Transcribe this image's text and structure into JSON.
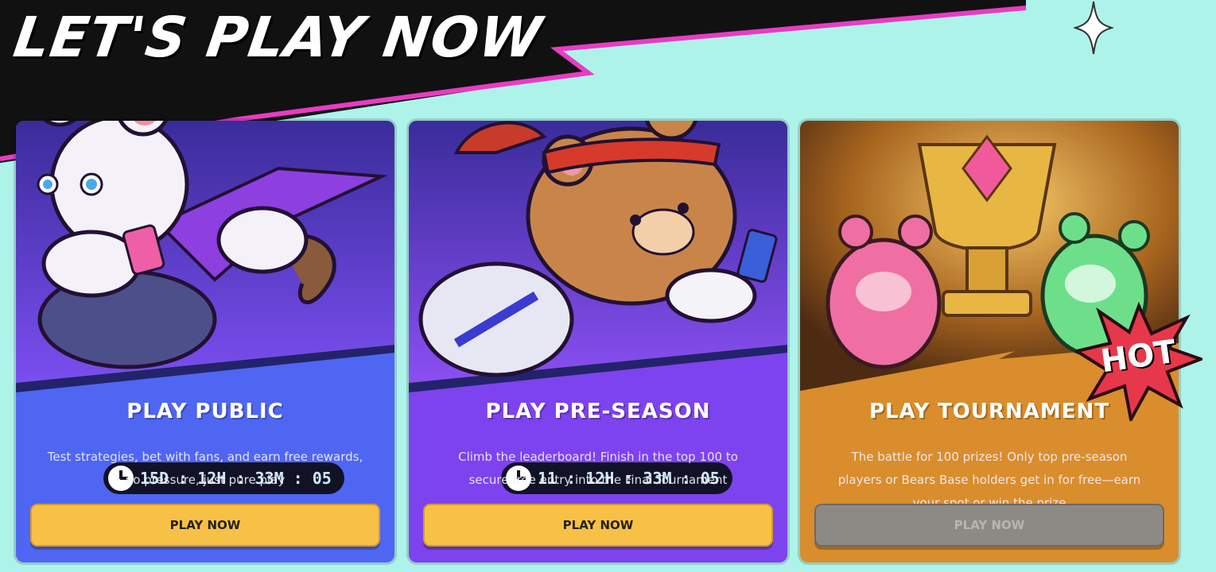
{
  "header": {
    "title": "LET'S PLAY NOW"
  },
  "cards": [
    {
      "title": "PLAY PUBLIC",
      "description": "Test strategies, bet with fans, and earn free rewards, no pressure, just pure play",
      "button_label": "PLAY NOW",
      "timer": "15D : 12H : 33M : 05",
      "button_enabled": true,
      "accent": "#4f66f3"
    },
    {
      "title": "PLAY PRE-SEASON",
      "description": "Climb the leaderboard! Finish in the top 100 to secure free entry into the Final Tournament",
      "button_label": "PLAY NOW",
      "timer": "11 : 12H : 33M : 05",
      "button_enabled": true,
      "accent": "#7d43ee"
    },
    {
      "title": "PLAY TOURNAMENT",
      "description": "The battle for 100 prizes! Only top pre-season players or Bears Base holders get in for free—earn your spot or win the prize",
      "button_label": "PLAY NOW",
      "badge": "HOT",
      "button_enabled": false,
      "accent": "#d98d2c"
    }
  ],
  "colors": {
    "background": "#aef3ea",
    "banner": "#111111",
    "banner_stripe": "#e83cc4",
    "button": "#f7c046",
    "button_disabled": "#8d8a86"
  }
}
